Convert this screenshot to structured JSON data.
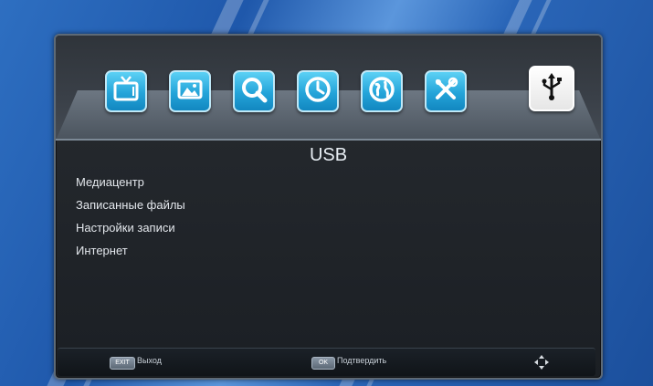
{
  "header": {
    "title": "USB"
  },
  "icons": [
    {
      "name": "tv-icon",
      "active": false
    },
    {
      "name": "image-icon",
      "active": false
    },
    {
      "name": "search-icon",
      "active": false
    },
    {
      "name": "clock-icon",
      "active": false
    },
    {
      "name": "globe-icon",
      "active": false
    },
    {
      "name": "tools-icon",
      "active": false
    },
    {
      "name": "usb-icon",
      "active": true
    }
  ],
  "menu": {
    "items": [
      {
        "label": "Медиацентр"
      },
      {
        "label": "Записанные файлы"
      },
      {
        "label": "Настройки записи"
      },
      {
        "label": "Интернет"
      }
    ]
  },
  "footer": {
    "exit_key": "EXIT",
    "exit_label": "Выход",
    "ok_key": "OK",
    "ok_label": "Подтвердить",
    "nav_icon": "dpad-icon"
  },
  "colors": {
    "accent": "#24a4d9",
    "active_tile": "#ffffff",
    "background": "#2a66b8"
  }
}
